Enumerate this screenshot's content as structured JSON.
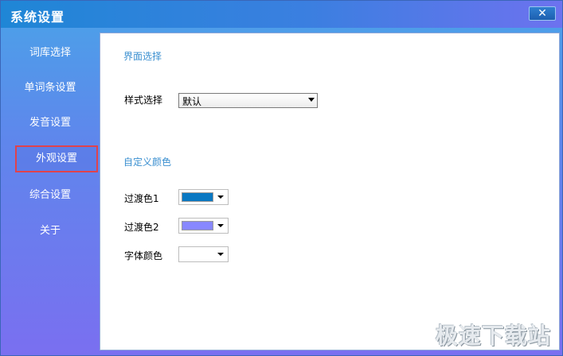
{
  "window": {
    "title": "系统设置",
    "close_label": "✕"
  },
  "sidebar": {
    "items": [
      {
        "label": "词库选择"
      },
      {
        "label": "单词条设置"
      },
      {
        "label": "发音设置"
      },
      {
        "label": "外观设置",
        "active": true
      },
      {
        "label": "综合设置"
      },
      {
        "label": "关于"
      }
    ]
  },
  "content": {
    "interface_section": {
      "title": "界面选择",
      "style_label": "样式选择",
      "style_value": "默认"
    },
    "custom_color_section": {
      "title": "自定义颜色",
      "gradient1_label": "过渡色1",
      "gradient1_color": "#0a78c2",
      "gradient2_label": "过渡色2",
      "gradient2_color": "#8888ff",
      "font_color_label": "字体颜色",
      "font_color": "#ffffff"
    }
  },
  "watermark": "极速下载站",
  "colors": {
    "accent": "#3a8fd0",
    "active_border": "#e0424c"
  }
}
